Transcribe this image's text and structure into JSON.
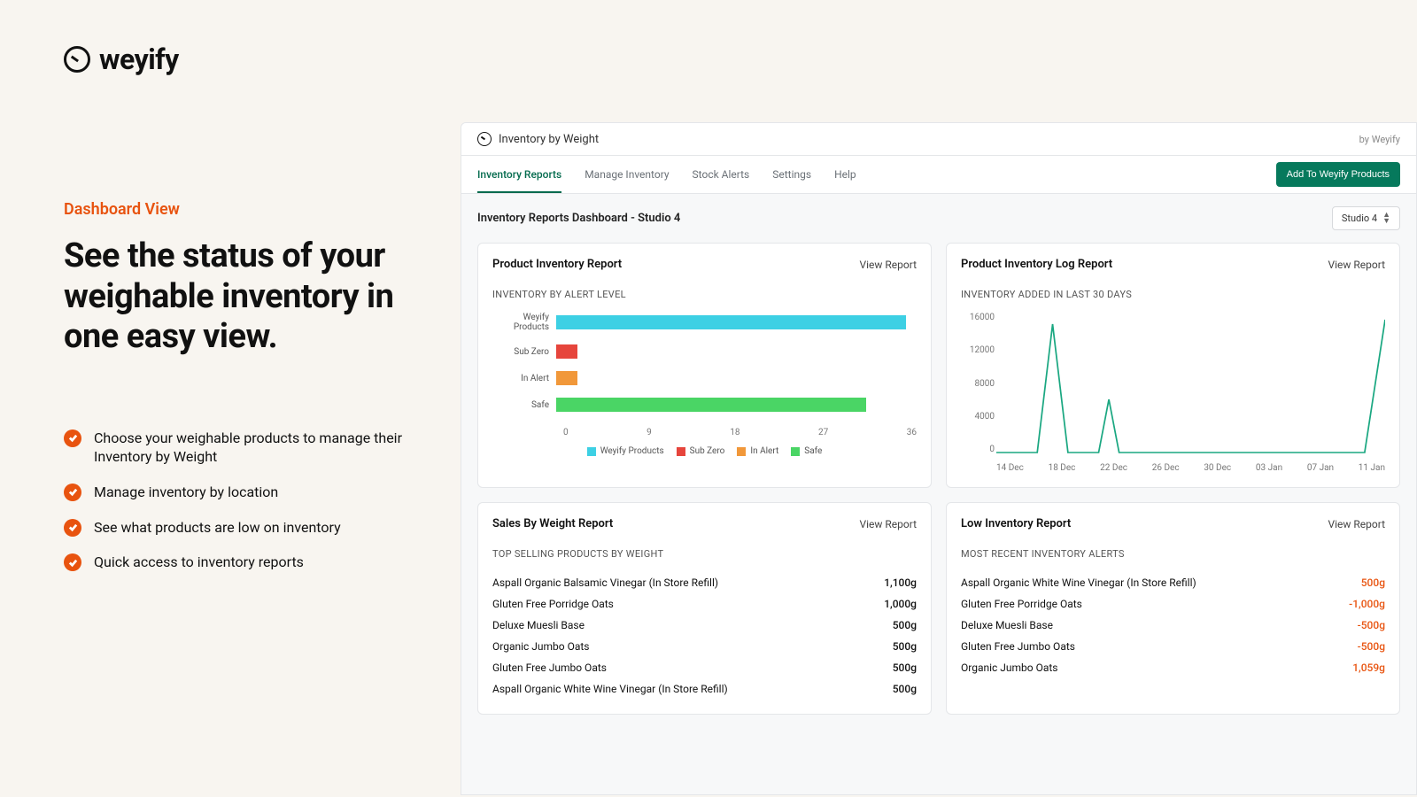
{
  "brand": "weyify",
  "marketing": {
    "eyebrow": "Dashboard View",
    "headline": "See the status of your weighable inventory in one easy view.",
    "features": [
      "Choose your weighable products to manage their Inventory by Weight",
      "Manage inventory by location",
      "See what products are low on inventory",
      "Quick access to inventory reports"
    ]
  },
  "app": {
    "header_title": "Inventory by Weight",
    "by_brand": "by Weyify",
    "tabs": [
      "Inventory Reports",
      "Manage Inventory",
      "Stock Alerts",
      "Settings",
      "Help"
    ],
    "primary_button": "Add To Weyify Products",
    "sub_title": "Inventory Reports Dashboard - Studio 4",
    "location": "Studio 4"
  },
  "cards": {
    "product_inventory": {
      "title": "Product Inventory Report",
      "view": "View Report",
      "subtitle": "INVENTORY BY ALERT LEVEL"
    },
    "log": {
      "title": "Product Inventory Log Report",
      "view": "View Report",
      "subtitle": "INVENTORY ADDED IN LAST 30 DAYS"
    },
    "sales": {
      "title": "Sales By Weight Report",
      "view": "View Report",
      "subtitle": "TOP SELLING PRODUCTS BY WEIGHT",
      "rows": [
        {
          "name": "Aspall Organic Balsamic Vinegar (In Store Refill)",
          "val": "1,100g"
        },
        {
          "name": "Gluten Free Porridge Oats",
          "val": "1,000g"
        },
        {
          "name": "Deluxe Muesli Base",
          "val": "500g"
        },
        {
          "name": "Organic Jumbo Oats",
          "val": "500g"
        },
        {
          "name": "Gluten Free Jumbo Oats",
          "val": "500g"
        },
        {
          "name": "Aspall Organic White Wine Vinegar (In Store Refill)",
          "val": "500g"
        }
      ]
    },
    "low": {
      "title": "Low Inventory Report",
      "view": "View Report",
      "subtitle": "MOST RECENT INVENTORY ALERTS",
      "rows": [
        {
          "name": "Aspall Organic White Wine Vinegar (In Store Refill)",
          "val": "500g"
        },
        {
          "name": "Gluten Free Porridge Oats",
          "val": "-1,000g"
        },
        {
          "name": "Deluxe Muesli Base",
          "val": "-500g"
        },
        {
          "name": "Gluten Free Jumbo Oats",
          "val": "-500g"
        },
        {
          "name": "Organic Jumbo Oats",
          "val": "1,059g"
        }
      ]
    }
  },
  "colors": {
    "cyan": "#3dd0e4",
    "red": "#e6453c",
    "orange": "#f1983a",
    "green": "#4ad565",
    "teal": "#1aa781"
  },
  "chart_data": [
    {
      "type": "bar",
      "title": "Inventory by Alert Level",
      "xlabel": "",
      "ylabel": "",
      "xlim": [
        0,
        36
      ],
      "categories": [
        "Weyify Products",
        "Sub Zero",
        "In Alert",
        "Safe"
      ],
      "values": [
        35,
        2,
        2,
        31
      ],
      "colors": [
        "#3dd0e4",
        "#e6453c",
        "#f1983a",
        "#4ad565"
      ],
      "x_ticks": [
        0,
        9,
        18,
        27,
        36
      ],
      "legend": [
        "Weyify Products",
        "Sub Zero",
        "In Alert",
        "Safe"
      ]
    },
    {
      "type": "line",
      "title": "Inventory Added in Last 30 Days",
      "xlabel": "",
      "ylabel": "",
      "ylim": [
        0,
        16000
      ],
      "y_ticks": [
        0,
        4000,
        8000,
        12000,
        16000
      ],
      "x_ticks": [
        "14 Dec",
        "18 Dec",
        "22 Dec",
        "26 Dec",
        "30 Dec",
        "03 Jan",
        "07 Jan",
        "11 Jan"
      ],
      "x": [
        0,
        1,
        2,
        3,
        4,
        5,
        6,
        7,
        8,
        9,
        10,
        11,
        12,
        13,
        14,
        15,
        16,
        17,
        18,
        19,
        20,
        21,
        22,
        23,
        24,
        25,
        26,
        27,
        28
      ],
      "values": [
        0,
        0,
        0,
        0,
        14500,
        0,
        0,
        0,
        6000,
        0,
        0,
        0,
        0,
        0,
        0,
        0,
        0,
        0,
        0,
        0,
        0,
        0,
        0,
        0,
        0,
        0,
        0,
        0,
        15000
      ]
    }
  ]
}
